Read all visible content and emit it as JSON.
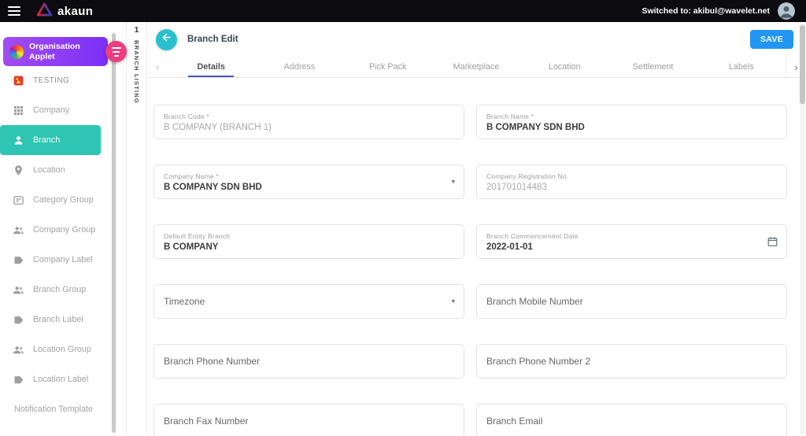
{
  "topbar": {
    "app_name": "akaun",
    "switched_label": "Switched to: akibul@wavelet.net",
    "icons": [
      "hamburger-icon",
      "logo-triangle-icon",
      "user-avatar"
    ]
  },
  "sidebar": {
    "applet_name": "Organisation Applet",
    "items": [
      {
        "label": "TESTING",
        "icon": "testing-applet-icon",
        "active": false
      },
      {
        "label": "Company",
        "icon": "company-grid-icon",
        "active": false
      },
      {
        "label": "Branch",
        "icon": "person-icon",
        "active": true
      },
      {
        "label": "Location",
        "icon": "map-pin-icon",
        "active": false
      },
      {
        "label": "Category Group",
        "icon": "category-card-icon",
        "active": false
      },
      {
        "label": "Company Group",
        "icon": "people-icon",
        "active": false
      },
      {
        "label": "Company Label",
        "icon": "tag-icon",
        "active": false
      },
      {
        "label": "Branch Group",
        "icon": "people-icon",
        "active": false
      },
      {
        "label": "Branch Label",
        "icon": "tag-icon",
        "active": false
      },
      {
        "label": "Location Group",
        "icon": "people-icon",
        "active": false
      },
      {
        "label": "Location Label",
        "icon": "tag-icon",
        "active": false
      },
      {
        "label": "Notification Template",
        "icon": null,
        "active": false
      }
    ]
  },
  "listing_tab": {
    "index": "1",
    "label": "BRANCH LISTING"
  },
  "page": {
    "title": "Branch Edit",
    "save_button": "SAVE",
    "active_tab": "Details",
    "tabs": [
      "Details",
      "Address",
      "Pick Pack",
      "Marketplace",
      "Location",
      "Settlement",
      "Labels"
    ],
    "tab_scroll_left": "‹",
    "tab_scroll_right": "›",
    "dropdown_caret": "▾"
  },
  "form": {
    "fields": [
      {
        "label": "Branch Code *",
        "value": "B COMPANY (BRANCH 1)",
        "disabled": true,
        "adornment": null
      },
      {
        "label": "Branch Name *",
        "value": "B COMPANY SDN BHD",
        "disabled": false,
        "adornment": null
      },
      {
        "label": "Company Name *",
        "value": "B COMPANY SDN BHD",
        "disabled": false,
        "adornment": "dropdown"
      },
      {
        "label": "Company Registration No.",
        "value": "201701014483",
        "disabled": true,
        "adornment": null
      },
      {
        "label": "Default Entity Branch",
        "value": "B COMPANY",
        "disabled": false,
        "adornment": null
      },
      {
        "label": "Branch Commencement Date",
        "value": "2022-01-01",
        "disabled": false,
        "adornment": "calendar"
      },
      {
        "label": "Timezone",
        "value": "",
        "disabled": false,
        "adornment": "dropdown"
      },
      {
        "label": "Branch Mobile Number",
        "value": "",
        "disabled": false,
        "adornment": null
      },
      {
        "label": "Branch Phone Number",
        "value": "",
        "disabled": false,
        "adornment": null
      },
      {
        "label": "Branch Phone Number 2",
        "value": "",
        "disabled": false,
        "adornment": null
      },
      {
        "label": "Branch Fax Number",
        "value": "",
        "disabled": false,
        "adornment": null
      },
      {
        "label": "Branch Email",
        "value": "",
        "disabled": false,
        "adornment": null
      }
    ]
  },
  "colors": {
    "topbar_bg": "#0b0b10",
    "accent_teal": "#2ec5b2",
    "back_button_teal": "#2bc0cf",
    "save_blue": "#2196f3",
    "collapse_pink": "#ee3d7f",
    "applet_purple": "#7b2ff7",
    "tab_underline": "#4356c9"
  }
}
